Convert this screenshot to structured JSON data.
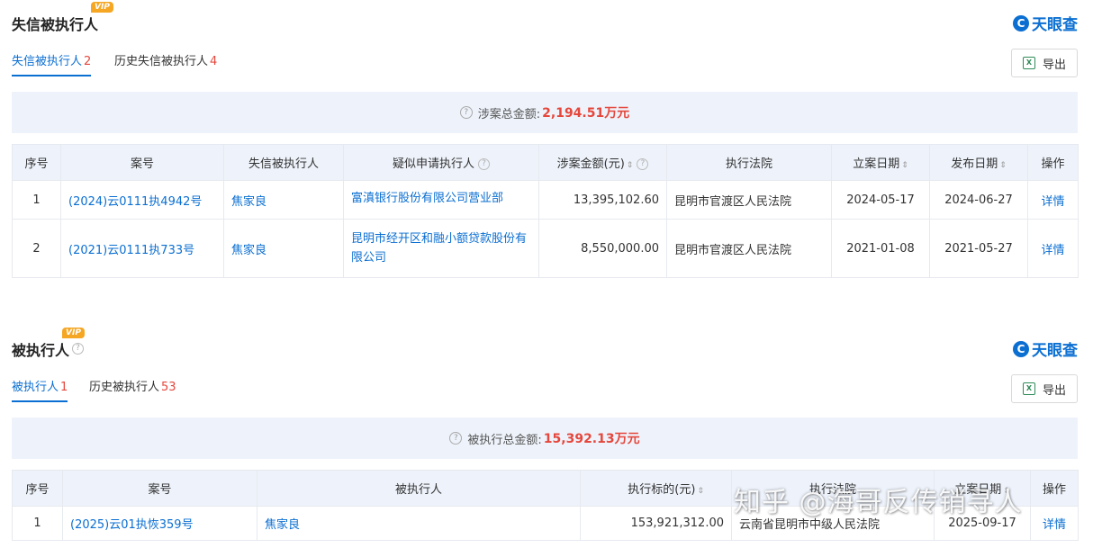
{
  "brand": {
    "logo_text": "天眼查",
    "logo_glyph": "C"
  },
  "vip_badge": "VIP",
  "export_label": "导出",
  "detail_label": "详情",
  "section1": {
    "title": "失信被执行人",
    "tabs": [
      {
        "label": "失信被执行人",
        "count": "2",
        "active": true
      },
      {
        "label": "历史失信被执行人",
        "count": "4",
        "active": false
      }
    ],
    "total_label": "涉案总金额:",
    "total_amount": "2,194.51万元",
    "headers": [
      "序号",
      "案号",
      "失信被执行人",
      "疑似申请执行人",
      "涉案金额(元)",
      "执行法院",
      "立案日期",
      "发布日期",
      "操作"
    ],
    "rows": [
      {
        "index": "1",
        "case_no": "(2024)云0111执4942号",
        "person": "焦家良",
        "applicant": "富滇银行股份有限公司营业部",
        "amount": "13,395,102.60",
        "court": "昆明市官渡区人民法院",
        "filed": "2024-05-17",
        "published": "2024-06-27"
      },
      {
        "index": "2",
        "case_no": "(2021)云0111执733号",
        "person": "焦家良",
        "applicant": "昆明市经开区和融小额贷款股份有限公司",
        "amount": "8,550,000.00",
        "court": "昆明市官渡区人民法院",
        "filed": "2021-01-08",
        "published": "2021-05-27"
      }
    ]
  },
  "section2": {
    "title": "被执行人",
    "tabs": [
      {
        "label": "被执行人",
        "count": "1",
        "active": true
      },
      {
        "label": "历史被执行人",
        "count": "53",
        "active": false
      }
    ],
    "total_label": "被执行总金额:",
    "total_amount": "15,392.13万元",
    "headers": [
      "序号",
      "案号",
      "被执行人",
      "执行标的(元)",
      "执行法院",
      "立案日期",
      "操作"
    ],
    "rows": [
      {
        "index": "1",
        "case_no": "(2025)云01执恢359号",
        "person": "焦家良",
        "target": "153,921,312.00",
        "court": "云南省昆明市中级人民法院",
        "filed": "2025-09-17"
      }
    ]
  },
  "watermark": "知乎 @海哥反传销寻人"
}
